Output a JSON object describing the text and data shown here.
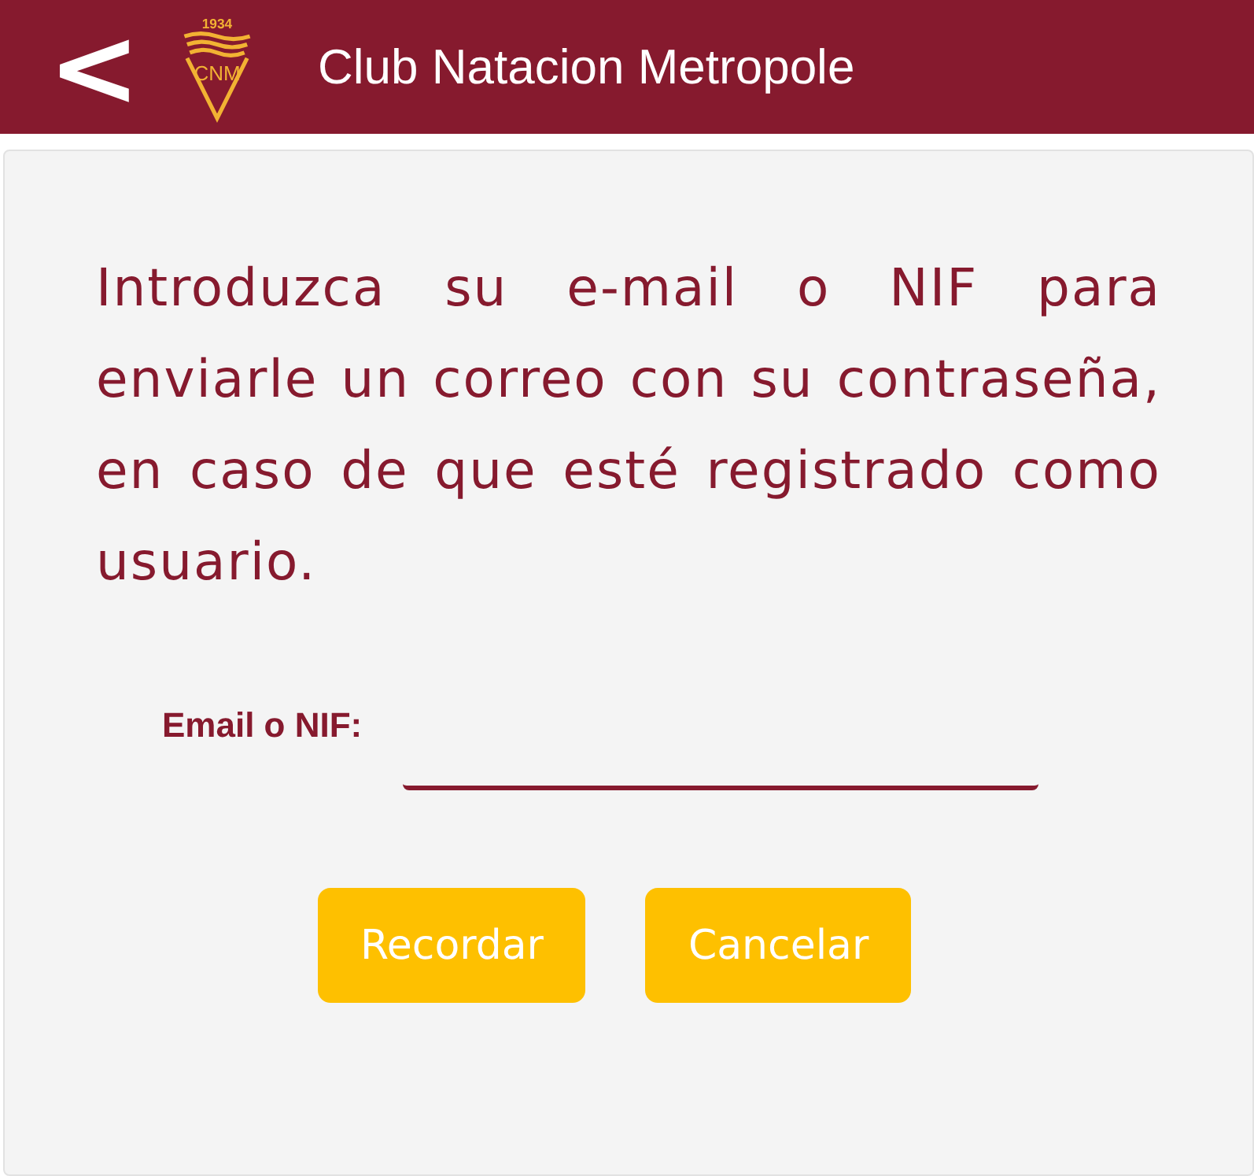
{
  "header": {
    "back": "<",
    "logo": {
      "year": "1934",
      "initials": "CNM"
    },
    "title": "Club Natacion Metropole"
  },
  "form": {
    "instructions": "Introduzca su e-mail o NIF para enviarle un correo con su contraseña, en caso de que esté registrado como usuario.",
    "field": {
      "label": "Email o NIF:"
    },
    "buttons": [
      {
        "label": "Recordar",
        "kind": "primary"
      },
      {
        "label": "Cancelar",
        "kind": "primary"
      }
    ]
  }
}
